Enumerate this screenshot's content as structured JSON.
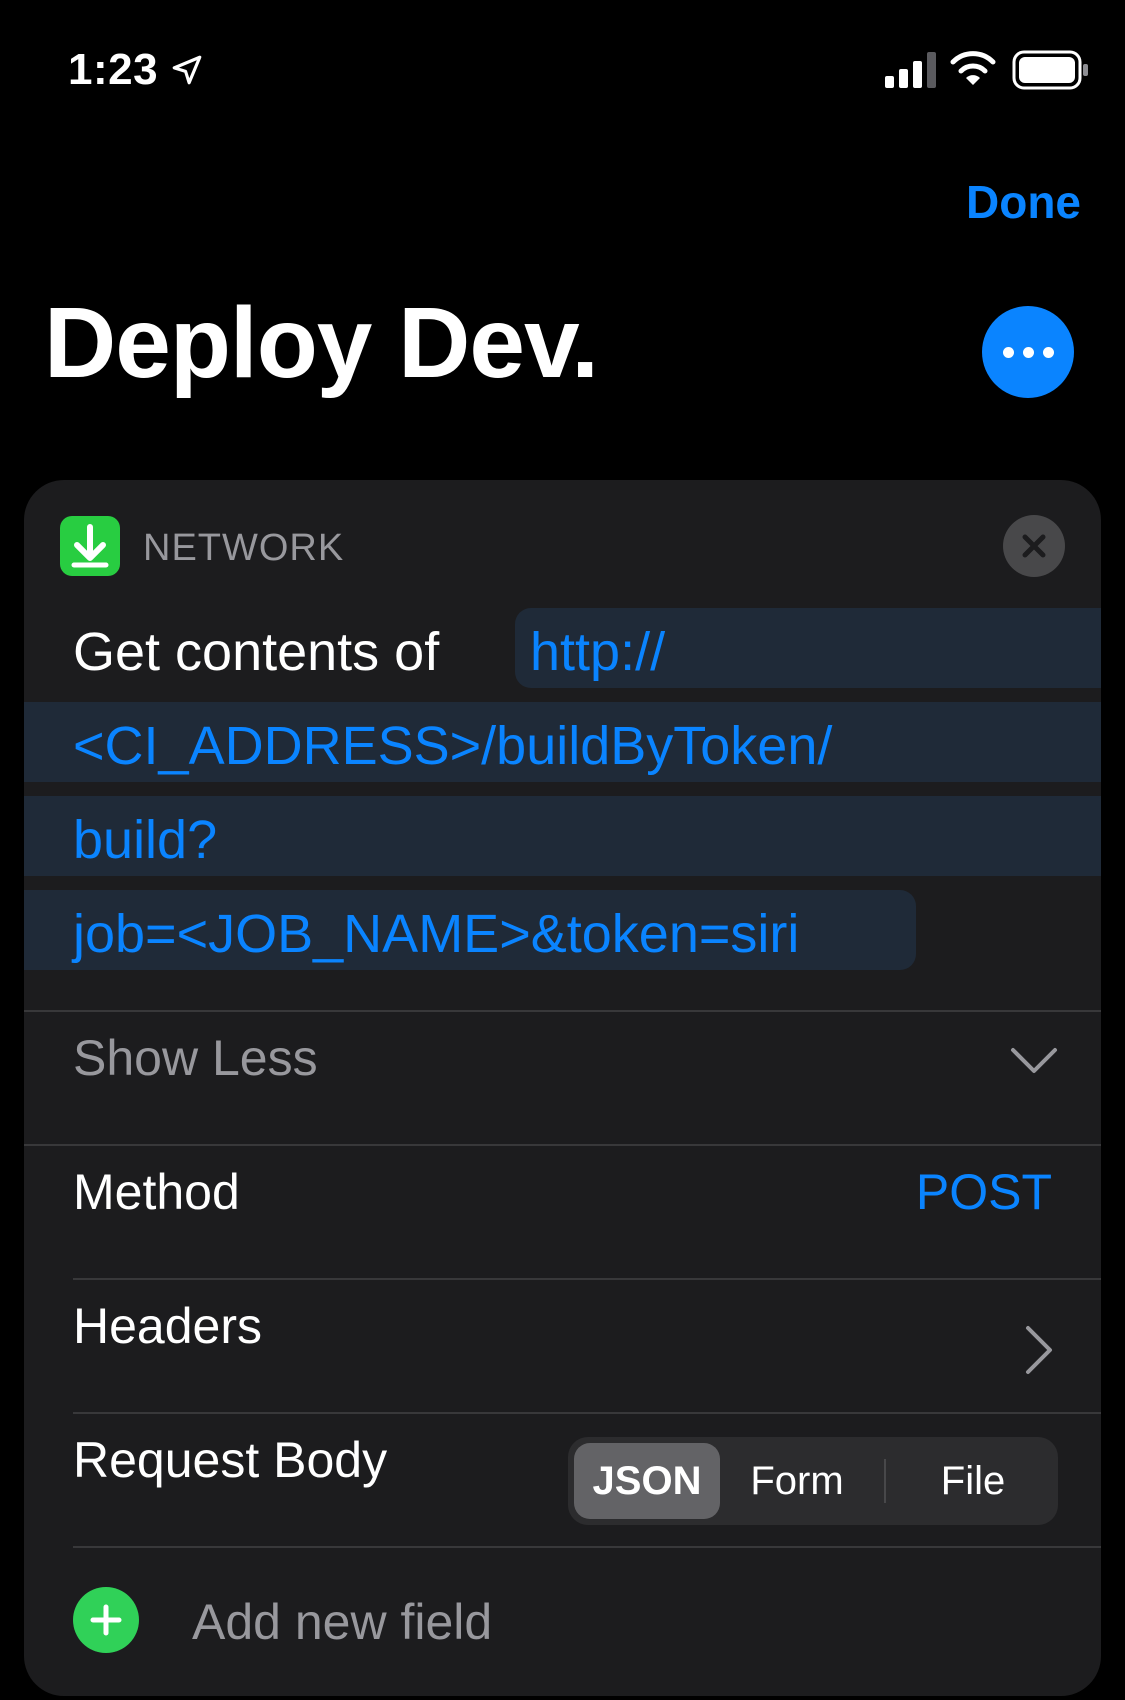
{
  "status_bar": {
    "time": "1:23",
    "icons": [
      "location-arrow-icon",
      "cellular-signal-icon",
      "wifi-icon",
      "battery-icon"
    ]
  },
  "nav": {
    "done_label": "Done",
    "title": "Deploy Dev.",
    "more_icon": "ellipsis-icon"
  },
  "action": {
    "category_label": "NETWORK",
    "category_icon": "download-arrow-icon",
    "close_icon": "close-icon",
    "get_label": "Get contents of",
    "url_lines": [
      "http://",
      "<CI_ADDRESS>/buildByToken/",
      "build?",
      "job=<JOB_NAME>&token=siri"
    ],
    "show_less_label": "Show Less",
    "method_label": "Method",
    "method_value": "POST",
    "headers_label": "Headers",
    "request_body_label": "Request Body",
    "body_options": [
      "JSON",
      "Form",
      "File"
    ],
    "body_selected": "JSON",
    "add_field_label": "Add new field"
  },
  "colors": {
    "accent": "#0a84ff",
    "background": "#000000",
    "card": "#1c1c1e",
    "network_green": "#28cd41",
    "add_green": "#30d158"
  }
}
